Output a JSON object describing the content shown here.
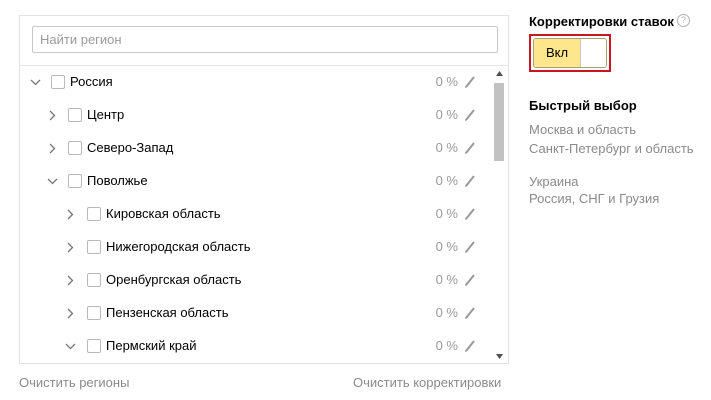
{
  "search": {
    "placeholder": "Найти регион",
    "value": ""
  },
  "tree": {
    "rows": [
      {
        "label": "Россия",
        "percent": "0 %",
        "expanded": true
      },
      {
        "label": "Центр",
        "percent": "0 %",
        "expanded": false
      },
      {
        "label": "Северо-Запад",
        "percent": "0 %",
        "expanded": false
      },
      {
        "label": "Поволжье",
        "percent": "0 %",
        "expanded": true
      },
      {
        "label": "Кировская область",
        "percent": "0 %",
        "expanded": false
      },
      {
        "label": "Нижегородская область",
        "percent": "0 %",
        "expanded": false
      },
      {
        "label": "Оренбургская область",
        "percent": "0 %",
        "expanded": false
      },
      {
        "label": "Пензенская область",
        "percent": "0 %",
        "expanded": false
      },
      {
        "label": "Пермский край",
        "percent": "0 %",
        "expanded": true
      }
    ]
  },
  "footer": {
    "clear_regions": "Очистить регионы",
    "clear_adjustments": "Очистить корректировки"
  },
  "bid_adjustments": {
    "title": "Корректировки ставок",
    "help": "?",
    "toggle_label": "Вкл",
    "toggle_state": "on"
  },
  "quick_select": {
    "title": "Быстрый выбор",
    "items": [
      "Москва и область",
      "Санкт-Петербург и область",
      "Украина",
      "Россия, СНГ и Грузия"
    ]
  },
  "colors": {
    "toggle_on": "#fee68c",
    "highlight_border": "#c8171e",
    "muted_text": "#8a8a8a"
  }
}
